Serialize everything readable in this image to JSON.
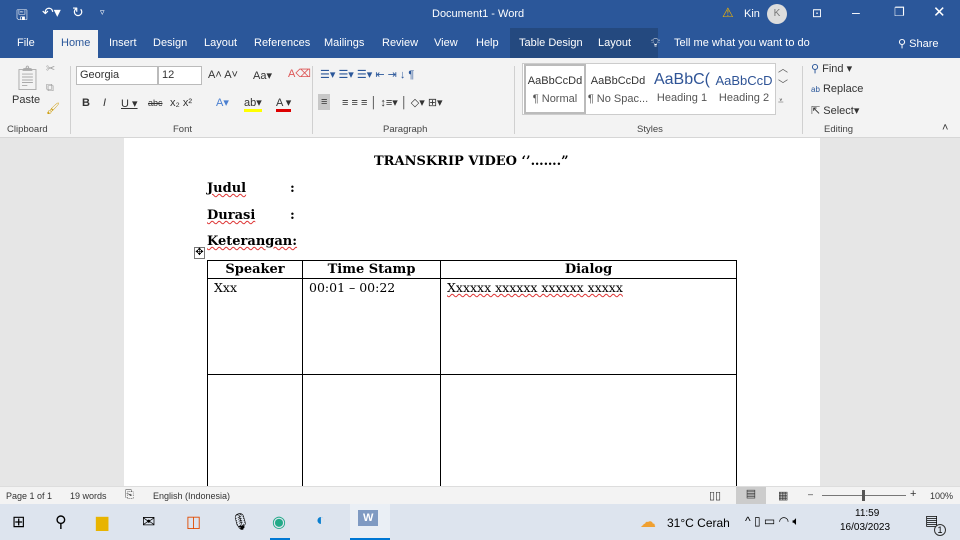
{
  "titlebar": {
    "doc_title": "Document1 - Word",
    "user": "Kin",
    "avatar_initial": "K"
  },
  "tabs": [
    "File",
    "Home",
    "Insert",
    "Design",
    "Layout",
    "References",
    "Mailings",
    "Review",
    "View",
    "Help",
    "Table Design",
    "Layout"
  ],
  "tell_me": "Tell me what you want to do",
  "share": "Share",
  "ribbon": {
    "clipboard": {
      "label": "Clipboard",
      "paste": "Paste"
    },
    "font": {
      "label": "Font",
      "family": "Georgia",
      "size": "12"
    },
    "paragraph": {
      "label": "Paragraph"
    },
    "styles": {
      "label": "Styles",
      "items": [
        {
          "preview": "AaBbCcDd",
          "name": "¶ Normal"
        },
        {
          "preview": "AaBbCcDd",
          "name": "¶ No Spac..."
        },
        {
          "preview": "AaBbC(",
          "name": "Heading 1"
        },
        {
          "preview": "AaBbCcD",
          "name": "Heading 2"
        }
      ]
    },
    "editing": {
      "label": "Editing",
      "find": "Find",
      "replace": "Replace",
      "select": "Select"
    }
  },
  "document": {
    "title": "TRANSKRIP VIDEO ‘’…….”",
    "fields": [
      {
        "label": "Judul",
        "sep": ":"
      },
      {
        "label": "Durasi",
        "sep": ":"
      },
      {
        "label": "Keterangan:",
        "sep": ""
      }
    ],
    "table": {
      "headers": [
        "Speaker",
        "Time Stamp",
        "Dialog"
      ],
      "rows": [
        [
          "Xxx",
          "00:01 – 00:22",
          "Xxxxxx xxxxxx xxxxxx xxxxx"
        ],
        [
          "",
          "",
          ""
        ]
      ]
    }
  },
  "status": {
    "page": "Page 1 of 1",
    "words": "19 words",
    "language": "English (Indonesia)",
    "zoom": "100%"
  },
  "taskbar": {
    "weather": "31°C Cerah",
    "time": "11:59",
    "date": "16/03/2023",
    "notifications": "1"
  }
}
